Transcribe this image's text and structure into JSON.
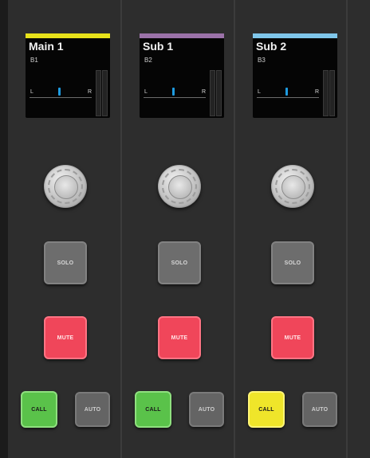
{
  "channels": [
    {
      "name": "Main 1",
      "bus": "B1",
      "color": "#e8e21a",
      "pan_left": "L",
      "pan_right": "R",
      "solo_label": "SOLO",
      "mute_label": "MUTE",
      "call_label": "CALL",
      "call_color": "green",
      "auto_label": "AUTO"
    },
    {
      "name": "Sub 1",
      "bus": "B2",
      "color": "#9b72a8",
      "pan_left": "L",
      "pan_right": "R",
      "solo_label": "SOLO",
      "mute_label": "MUTE",
      "call_label": "CALL",
      "call_color": "green",
      "auto_label": "AUTO"
    },
    {
      "name": "Sub 2",
      "bus": "B3",
      "color": "#7fc6ea",
      "pan_left": "L",
      "pan_right": "R",
      "solo_label": "SOLO",
      "mute_label": "MUTE",
      "call_label": "CALL",
      "call_color": "yellow",
      "auto_label": "AUTO"
    }
  ],
  "colors": {
    "pan_marker": "#1e9be0",
    "mute_red": "#f0465a",
    "call_green": "#5ac24a",
    "call_yellow": "#efe52a"
  }
}
